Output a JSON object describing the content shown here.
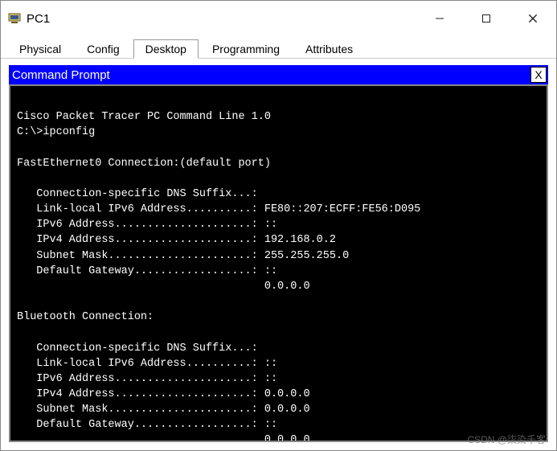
{
  "window": {
    "title": "PC1"
  },
  "tabs": {
    "items": [
      "Physical",
      "Config",
      "Desktop",
      "Programming",
      "Attributes"
    ],
    "active_index": 2
  },
  "command_prompt": {
    "title": "Command Prompt",
    "close_label": "X"
  },
  "terminal": {
    "banner": "Cisco Packet Tracer PC Command Line 1.0",
    "prompt": "C:\\>",
    "command": "ipconfig",
    "interfaces": [
      {
        "header": "FastEthernet0 Connection:(default port)",
        "dns_suffix": "",
        "link_local_ipv6": "FE80::207:ECFF:FE56:D095",
        "ipv6": "::",
        "ipv4": "192.168.0.2",
        "subnet_mask": "255.255.255.0",
        "default_gateway": "::",
        "default_gateway2": "0.0.0.0"
      },
      {
        "header": "Bluetooth Connection:",
        "dns_suffix": "",
        "link_local_ipv6": "::",
        "ipv6": "::",
        "ipv4": "0.0.0.0",
        "subnet_mask": "0.0.0.0",
        "default_gateway": "::",
        "default_gateway2": "0.0.0.0"
      }
    ]
  },
  "watermark": "CSDN @柒染千客"
}
